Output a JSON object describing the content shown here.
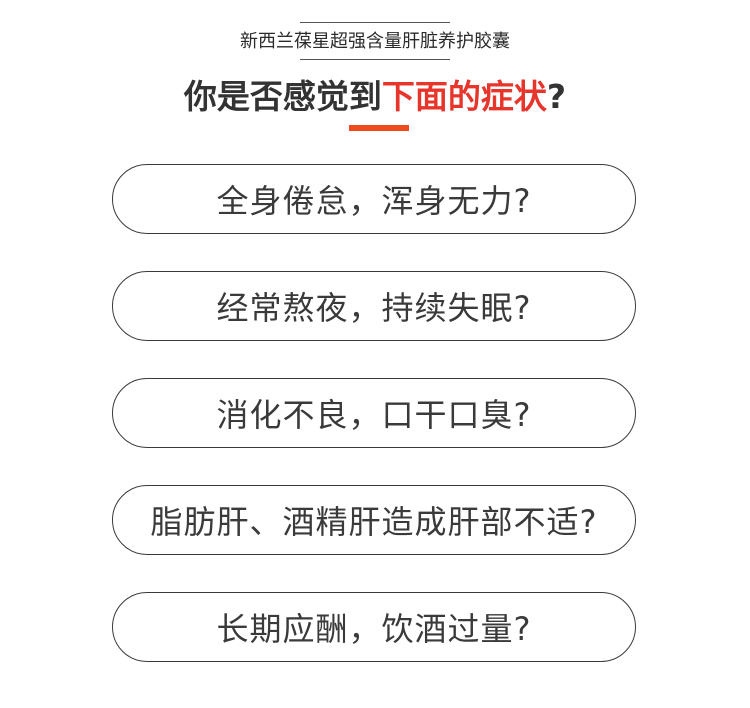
{
  "header": {
    "brand_title": "新西兰葆星超强含量肝脏养护胶囊",
    "headline_part1": "你是否感觉到",
    "headline_highlight": "下面的症状",
    "headline_part2": "?"
  },
  "symptoms": [
    "全身倦怠，浑身无力?",
    "经常熬夜，持续失眠?",
    "消化不良，口干口臭?",
    "脂肪肝、酒精肝造成肝部不适?",
    "长期应酬，饮酒过量?"
  ],
  "colors": {
    "highlight": "#e8352b",
    "accent_bar": "#ee4a1b",
    "text": "#333333"
  }
}
